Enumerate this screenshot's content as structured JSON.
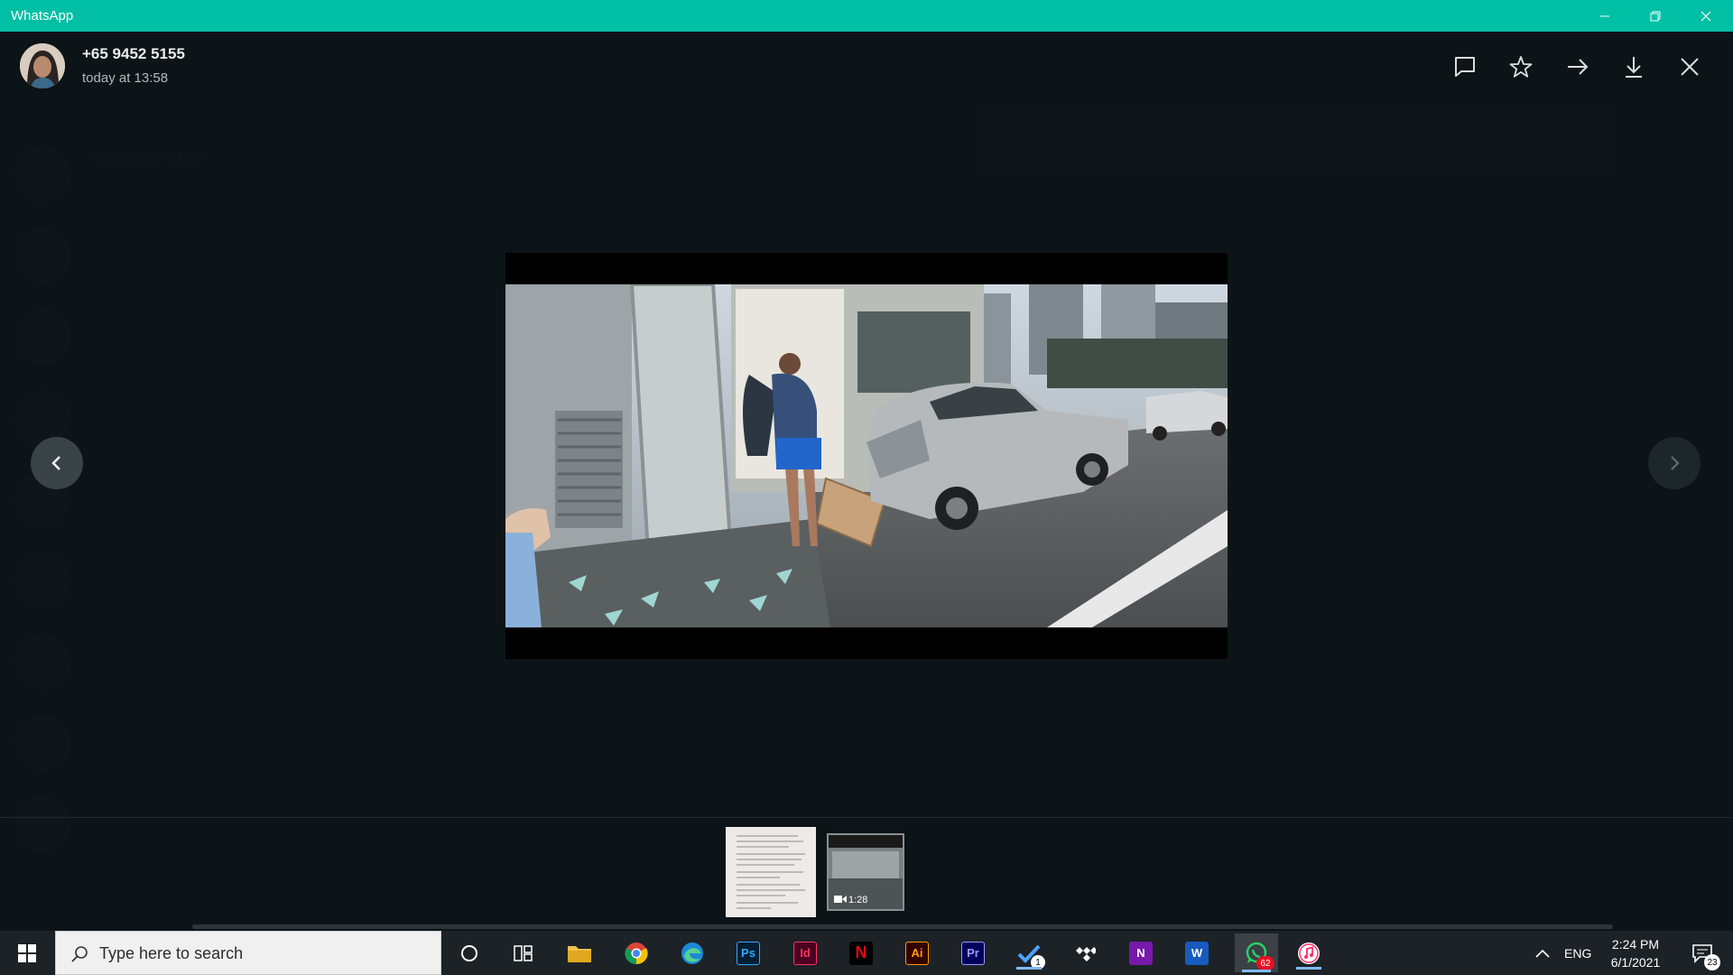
{
  "window": {
    "title": "WhatsApp"
  },
  "background_list": [
    {
      "name": "+65 9452 5155",
      "message": ""
    },
    {
      "name": "",
      "message": ""
    },
    {
      "name": "",
      "message": ""
    },
    {
      "name": "",
      "message": ""
    },
    {
      "name": "",
      "message": ""
    },
    {
      "name": "",
      "message": ""
    },
    {
      "name": "",
      "message": ""
    },
    {
      "name": "",
      "message": ""
    },
    {
      "name": "",
      "message": ""
    }
  ],
  "viewer": {
    "sender": "+65 9452 5155",
    "timestamp": "today at 13:58",
    "actions": [
      "reply-icon",
      "star-icon",
      "forward-icon",
      "download-icon",
      "close-icon"
    ]
  },
  "thumbnails": [
    {
      "type": "document"
    },
    {
      "type": "video",
      "duration": "1:28"
    }
  ],
  "taskbar": {
    "search_placeholder": "Type here to search",
    "apps": [
      {
        "name": "Photoshop",
        "label": "Ps",
        "color": "#31a8ff",
        "bg": "#001e36"
      },
      {
        "name": "InDesign",
        "label": "Id",
        "color": "#ff3366",
        "bg": "#49021f"
      },
      {
        "name": "Netflix",
        "label": "N",
        "color": "#e50914",
        "bg": "#000000"
      },
      {
        "name": "Illustrator",
        "label": "Ai",
        "color": "#ff9a00",
        "bg": "#330000"
      },
      {
        "name": "Premiere",
        "label": "Pr",
        "color": "#9999ff",
        "bg": "#00005b"
      },
      {
        "name": "OneNote",
        "label": "N",
        "color": "#ffffff",
        "bg": "#7719aa"
      },
      {
        "name": "Word",
        "label": "W",
        "color": "#ffffff",
        "bg": "#185abd"
      }
    ],
    "todo_badge": "1",
    "whatsapp_badge": "62",
    "language": "ENG",
    "time": "2:24 PM",
    "date": "6/1/2021",
    "notification_count": "23"
  },
  "colors": {
    "titlebar": "#00bfa5",
    "background": "#131c21",
    "taskbar": "#1d2226"
  }
}
